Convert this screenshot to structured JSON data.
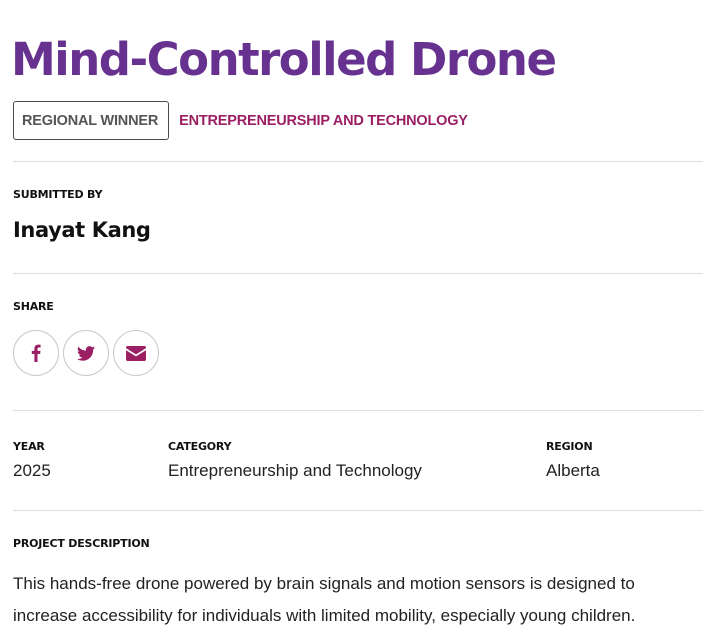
{
  "project": {
    "title": "Mind-Controlled Drone",
    "badge": "REGIONAL WINNER",
    "category_link": "ENTREPRENEURSHIP AND TECHNOLOGY"
  },
  "submitted": {
    "label": "SUBMITTED BY",
    "name": "Inayat Kang"
  },
  "share": {
    "label": "SHARE",
    "buttons": [
      {
        "network": "facebook",
        "icon": "facebook-icon"
      },
      {
        "network": "twitter",
        "icon": "twitter-icon"
      },
      {
        "network": "email",
        "icon": "envelope-icon"
      }
    ]
  },
  "details": {
    "year_label": "YEAR",
    "year": "2025",
    "category_label": "CATEGORY",
    "category": "Entrepreneurship and Technology",
    "region_label": "REGION",
    "region": "Alberta"
  },
  "description": {
    "label": "PROJECT DESCRIPTION",
    "text": "This hands-free drone powered by brain signals and motion sensors is designed to increase accessibility for individuals with limited mobility, especially young children."
  },
  "colors": {
    "title": "#66318f",
    "accent": "#9b1f63",
    "rule": "#dddddd"
  }
}
